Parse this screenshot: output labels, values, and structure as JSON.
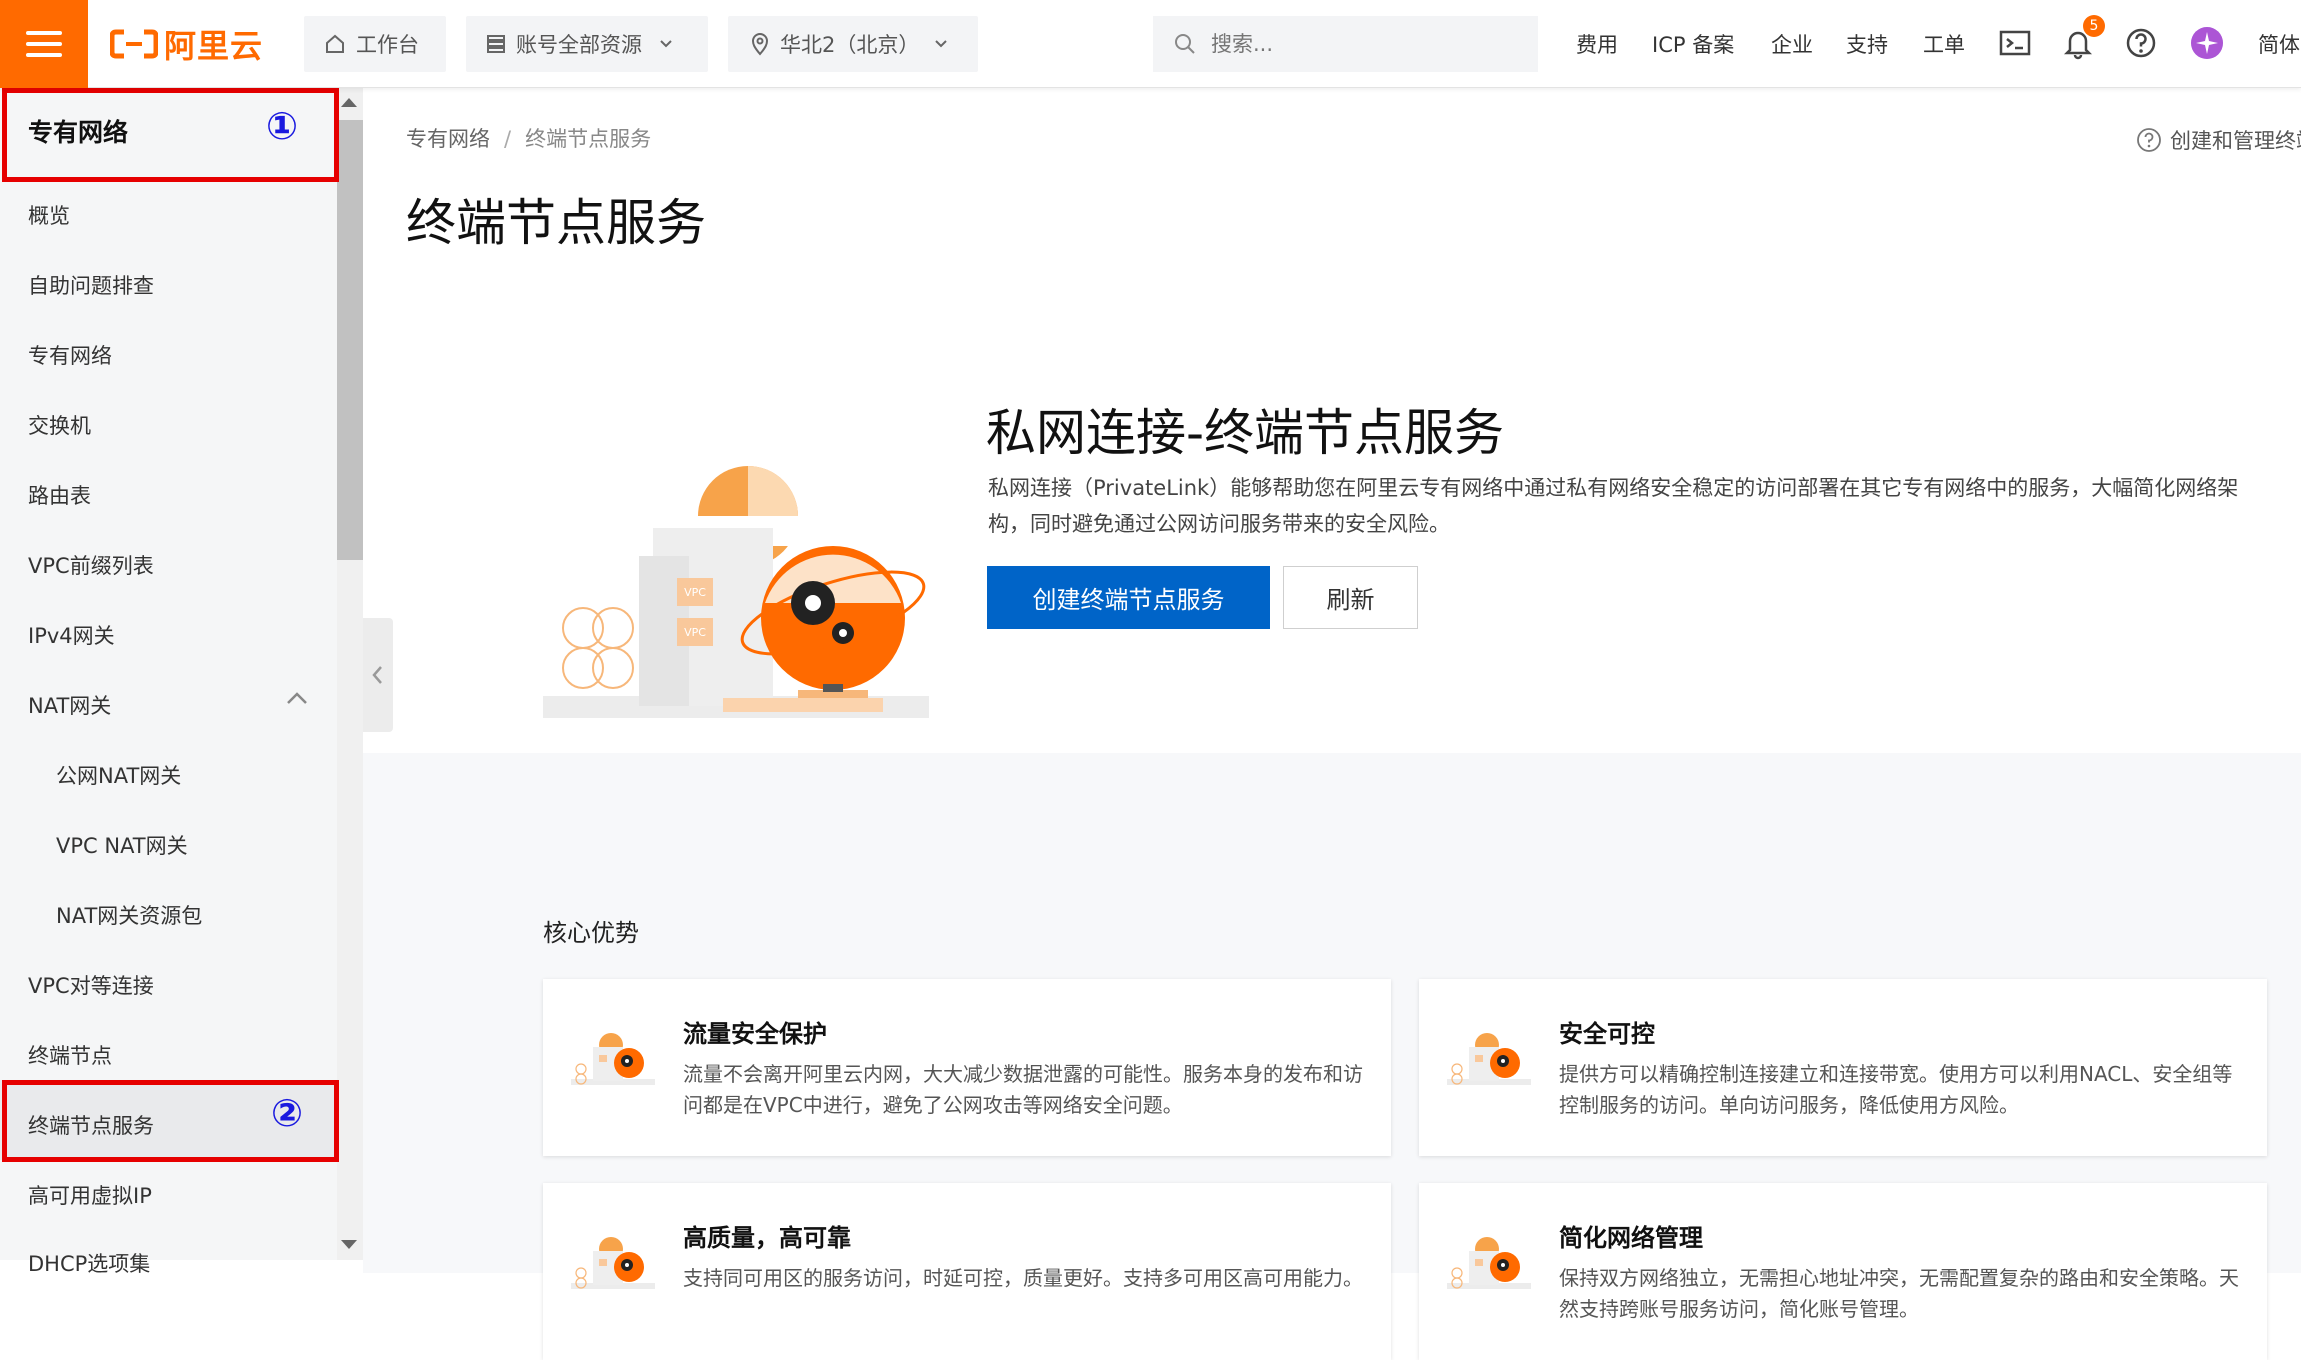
{
  "topbar": {
    "logo_text": "阿里云",
    "workbench": "工作台",
    "account_resources": "账号全部资源",
    "region": "华北2（北京）",
    "search_placeholder": "搜索...",
    "links": [
      "费用",
      "ICP 备案",
      "企业",
      "支持",
      "工单"
    ],
    "notification_count": "5",
    "language": "简体"
  },
  "sidebar": {
    "title": "专有网络",
    "items": [
      {
        "label": "概览"
      },
      {
        "label": "自助问题排查"
      },
      {
        "label": "专有网络"
      },
      {
        "label": "交换机"
      },
      {
        "label": "路由表"
      },
      {
        "label": "VPC前缀列表"
      },
      {
        "label": "IPv4网关"
      },
      {
        "label": "NAT网关"
      },
      {
        "label": "公网NAT网关"
      },
      {
        "label": "VPC NAT网关"
      },
      {
        "label": "NAT网关资源包"
      },
      {
        "label": "VPC对等连接"
      },
      {
        "label": "终端节点"
      },
      {
        "label": "终端节点服务"
      },
      {
        "label": "高可用虚拟IP"
      },
      {
        "label": "DHCP选项集"
      }
    ]
  },
  "annotations": {
    "one": "①",
    "two": "②"
  },
  "breadcrumb": {
    "parent": "专有网络",
    "separator": "/",
    "current": "终端节点服务"
  },
  "help_link": "创建和管理终端节点服务",
  "page_title": "终端节点服务",
  "hero": {
    "title": "私网连接-终端节点服务",
    "description": "私网连接（PrivateLink）能够帮助您在阿里云专有网络中通过私有网络安全稳定的访问部署在其它专有网络中的服务，大幅简化网络架构，同时避免通过公网访问服务带来的安全风险。",
    "primary_button": "创建终端节点服务",
    "secondary_button": "刷新",
    "illustration_label": "VPC"
  },
  "advantages": {
    "heading": "核心优势",
    "cards": [
      {
        "title": "流量安全保护",
        "desc": "流量不会离开阿里云内网，大大减少数据泄露的可能性。服务本身的发布和访问都是在VPC中进行，避免了公网攻击等网络安全问题。"
      },
      {
        "title": "安全可控",
        "desc": "提供方可以精确控制连接建立和连接带宽。使用方可以利用NACL、安全组等控制服务的访问。单向访问服务，降低使用方风险。"
      },
      {
        "title": "高质量，高可靠",
        "desc": "支持同可用区的服务访问，时延可控，质量更好。支持多可用区高可用能力。"
      },
      {
        "title": "简化网络管理",
        "desc": "保持双方网络独立，无需担心地址冲突，无需配置复杂的路由和安全策略。天然支持跨账号服务访问，简化账号管理。"
      }
    ]
  },
  "colors": {
    "brand": "#ff6a00",
    "primary": "#0064c8",
    "annotation_box": "#e60000",
    "annotation_num": "#1a1adf"
  }
}
